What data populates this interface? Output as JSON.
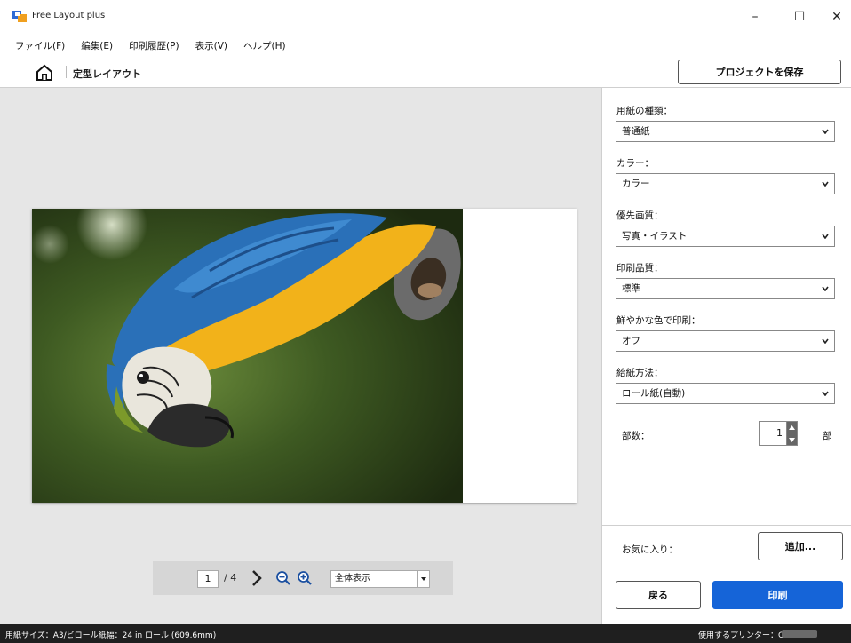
{
  "window": {
    "title": "Free Layout plus",
    "minimize": "–",
    "maximize": "☐",
    "close": "✕"
  },
  "menu": [
    "ファイル(F)",
    "編集(E)",
    "印刷履歴(P)",
    "表示(V)",
    "ヘルプ(H)"
  ],
  "breadcrumb": {
    "home_icon": "home-icon",
    "current": "定型レイアウト"
  },
  "toolbar": {
    "save_project": "プロジェクトを保存"
  },
  "preview": {
    "page_current": "1",
    "page_total": "/ 4",
    "zoom_option": "全体表示"
  },
  "settings": {
    "paper_type": {
      "label": "用紙の種類：",
      "value": "普通紙"
    },
    "color": {
      "label": "カラー：",
      "value": "カラー"
    },
    "priority_quality": {
      "label": "優先画質：",
      "value": "写真・イラスト"
    },
    "print_quality": {
      "label": "印刷品質：",
      "value": "標準"
    },
    "vivid": {
      "label": "鮮やかな色で印刷：",
      "value": "オフ"
    },
    "paper_source": {
      "label": "給紙方法：",
      "value": "ロール紙(自動)"
    },
    "copies": {
      "label": "部数：",
      "value": "1",
      "unit": "部"
    }
  },
  "favorites": {
    "label": "お気に入り：",
    "add": "追加..."
  },
  "actions": {
    "back": "戻る",
    "print": "印刷"
  },
  "status": {
    "left": "用紙サイズ：A3/ビロール紙幅：24 in ロール (609.6mm)",
    "right": "使用するプリンター：Canon"
  },
  "colors": {
    "accent": "#1564d8",
    "status_bar": "#1f1f1f"
  }
}
